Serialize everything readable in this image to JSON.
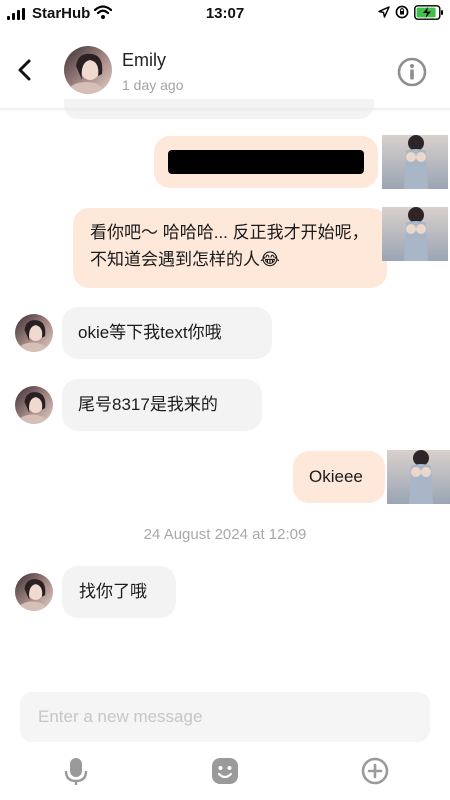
{
  "status_bar": {
    "carrier": "StarHub",
    "time": "13:07"
  },
  "header": {
    "contact_name": "Emily",
    "last_seen": "1 day ago"
  },
  "messages": [
    {
      "direction": "outgoing",
      "text": "",
      "redacted": true
    },
    {
      "direction": "outgoing",
      "text": "看你吧～ 哈哈哈... 反正我才开始呢，不知道会遇到怎样的人😂"
    },
    {
      "direction": "incoming",
      "text": "okie等下我text你哦"
    },
    {
      "direction": "incoming",
      "text": "尾号8317是我来的"
    },
    {
      "direction": "outgoing",
      "text": "Okieee"
    },
    {
      "direction": "incoming",
      "text": "找你了哦"
    }
  ],
  "date_separator": "24 August 2024 at 12:09",
  "composer": {
    "placeholder": "Enter a new message",
    "value": ""
  },
  "icons": {
    "back": "chevron-left-icon",
    "info": "info-icon",
    "mic": "microphone-icon",
    "emoji": "emoji-icon",
    "plus": "add-circle-icon"
  },
  "colors": {
    "outgoing_bubble": "#fde8da",
    "incoming_bubble": "#f3f3f4",
    "muted_text": "#a4a4a4",
    "icon_gray": "#9a9a9a"
  }
}
